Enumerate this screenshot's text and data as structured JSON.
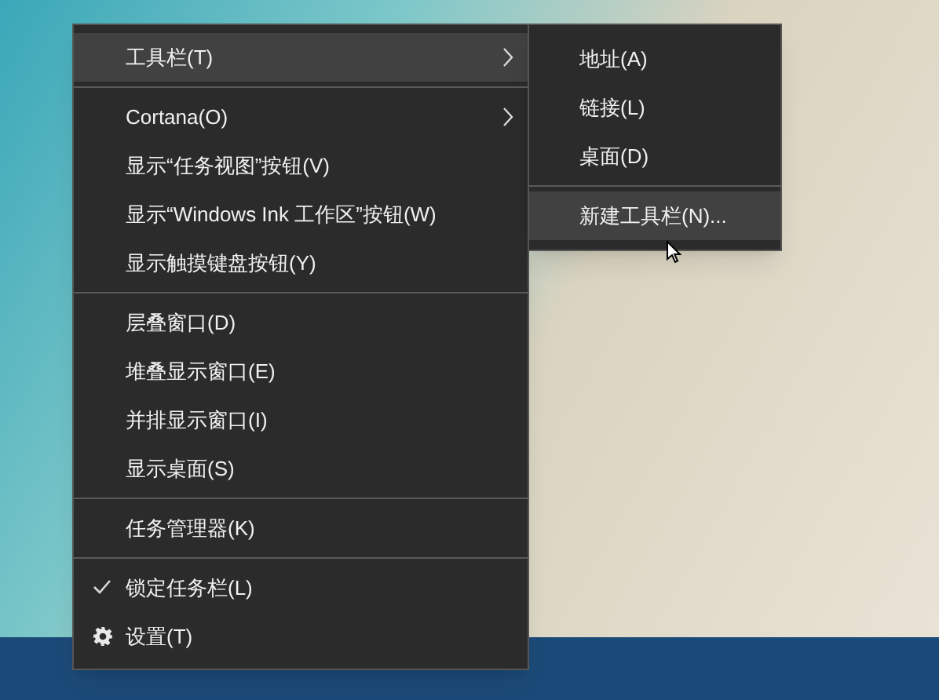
{
  "context_menu": {
    "items": [
      {
        "kind": "item",
        "label": "工具栏(T)",
        "selected": true,
        "submenu": true,
        "checked": false
      },
      {
        "kind": "separator"
      },
      {
        "kind": "item",
        "label": "Cortana(O)",
        "selected": false,
        "submenu": true,
        "checked": false
      },
      {
        "kind": "item",
        "label": "显示“任务视图”按钮(V)",
        "selected": false,
        "submenu": false,
        "checked": false
      },
      {
        "kind": "item",
        "label": "显示“Windows Ink 工作区”按钮(W)",
        "selected": false,
        "submenu": false,
        "checked": false
      },
      {
        "kind": "item",
        "label": "显示触摸键盘按钮(Y)",
        "selected": false,
        "submenu": false,
        "checked": false
      },
      {
        "kind": "separator"
      },
      {
        "kind": "item",
        "label": "层叠窗口(D)",
        "selected": false,
        "submenu": false,
        "checked": false
      },
      {
        "kind": "item",
        "label": "堆叠显示窗口(E)",
        "selected": false,
        "submenu": false,
        "checked": false
      },
      {
        "kind": "item",
        "label": "并排显示窗口(I)",
        "selected": false,
        "submenu": false,
        "checked": false
      },
      {
        "kind": "item",
        "label": "显示桌面(S)",
        "selected": false,
        "submenu": false,
        "checked": false
      },
      {
        "kind": "separator"
      },
      {
        "kind": "item",
        "label": "任务管理器(K)",
        "selected": false,
        "submenu": false,
        "checked": false
      },
      {
        "kind": "separator"
      },
      {
        "kind": "item",
        "label": "锁定任务栏(L)",
        "selected": false,
        "submenu": false,
        "checked": true
      },
      {
        "kind": "settings",
        "label": "设置(T)",
        "selected": false,
        "submenu": false,
        "checked": false
      }
    ]
  },
  "submenu": {
    "items": [
      {
        "kind": "item",
        "label": "地址(A)",
        "selected": false
      },
      {
        "kind": "item",
        "label": "链接(L)",
        "selected": false
      },
      {
        "kind": "item",
        "label": "桌面(D)",
        "selected": false
      },
      {
        "kind": "separator"
      },
      {
        "kind": "item",
        "label": "新建工具栏(N)...",
        "selected": true
      }
    ]
  }
}
